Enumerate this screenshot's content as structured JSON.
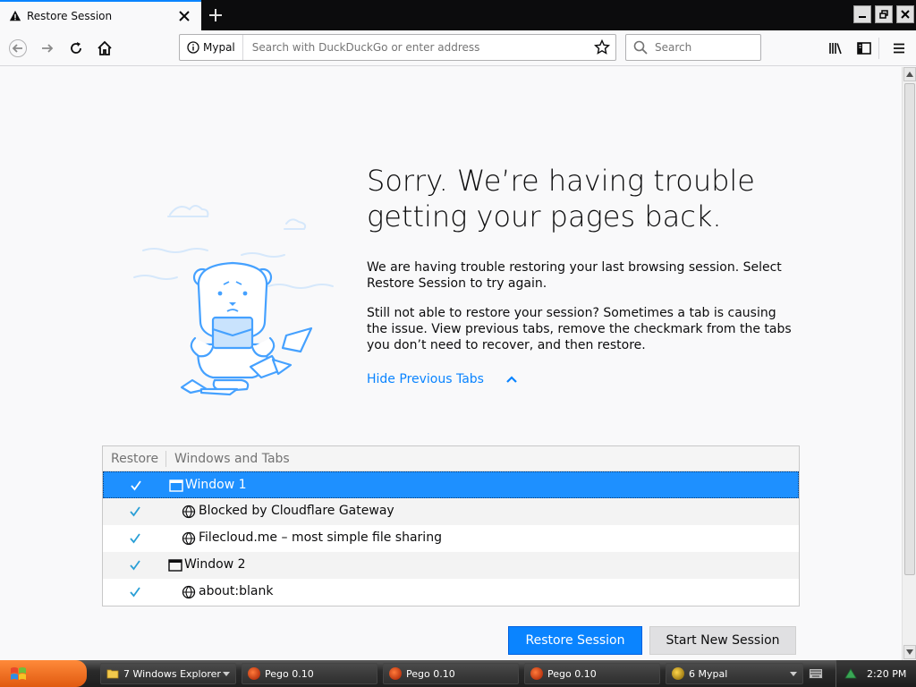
{
  "browser": {
    "tab_title": "Restore Session",
    "site_identity": "Mypal",
    "url_placeholder": "Search with DuckDuckGo or enter address",
    "search_placeholder": "Search"
  },
  "page": {
    "heading": "Sorry. We’re having trouble getting your pages back.",
    "para1": "We are having trouble restoring your last browsing session. Select Restore Session to try again.",
    "para2": "Still not able to restore your session? Sometimes a tab is causing the issue. View previous tabs, remove the checkmark from the tabs you don’t need to recover, and then restore.",
    "hide_tabs_label": "Hide Previous Tabs",
    "table": {
      "col_restore": "Restore",
      "col_windows": "Windows and Tabs",
      "rows": [
        {
          "label": "Window 1",
          "type": "window",
          "checked": true,
          "selected": true
        },
        {
          "label": "Blocked by Cloudflare Gateway",
          "type": "tab",
          "checked": true
        },
        {
          "label": "Filecloud.me – most simple file sharing",
          "type": "tab",
          "checked": true
        },
        {
          "label": "Window 2",
          "type": "window",
          "checked": true
        },
        {
          "label": "about:blank",
          "type": "tab",
          "checked": true
        }
      ]
    },
    "restore_button": "Restore Session",
    "new_session_button": "Start New Session"
  },
  "taskbar": {
    "items": [
      {
        "label": "7 Windows Explorer"
      },
      {
        "label": "Pego 0.10"
      },
      {
        "label": "Pego 0.10"
      },
      {
        "label": "Pego 0.10"
      },
      {
        "label": "6 Mypal"
      }
    ],
    "clock": "2:20 PM"
  },
  "colors": {
    "accent": "#0a84ff",
    "selection": "#1e90ff",
    "illustration": "#45a1ff"
  }
}
